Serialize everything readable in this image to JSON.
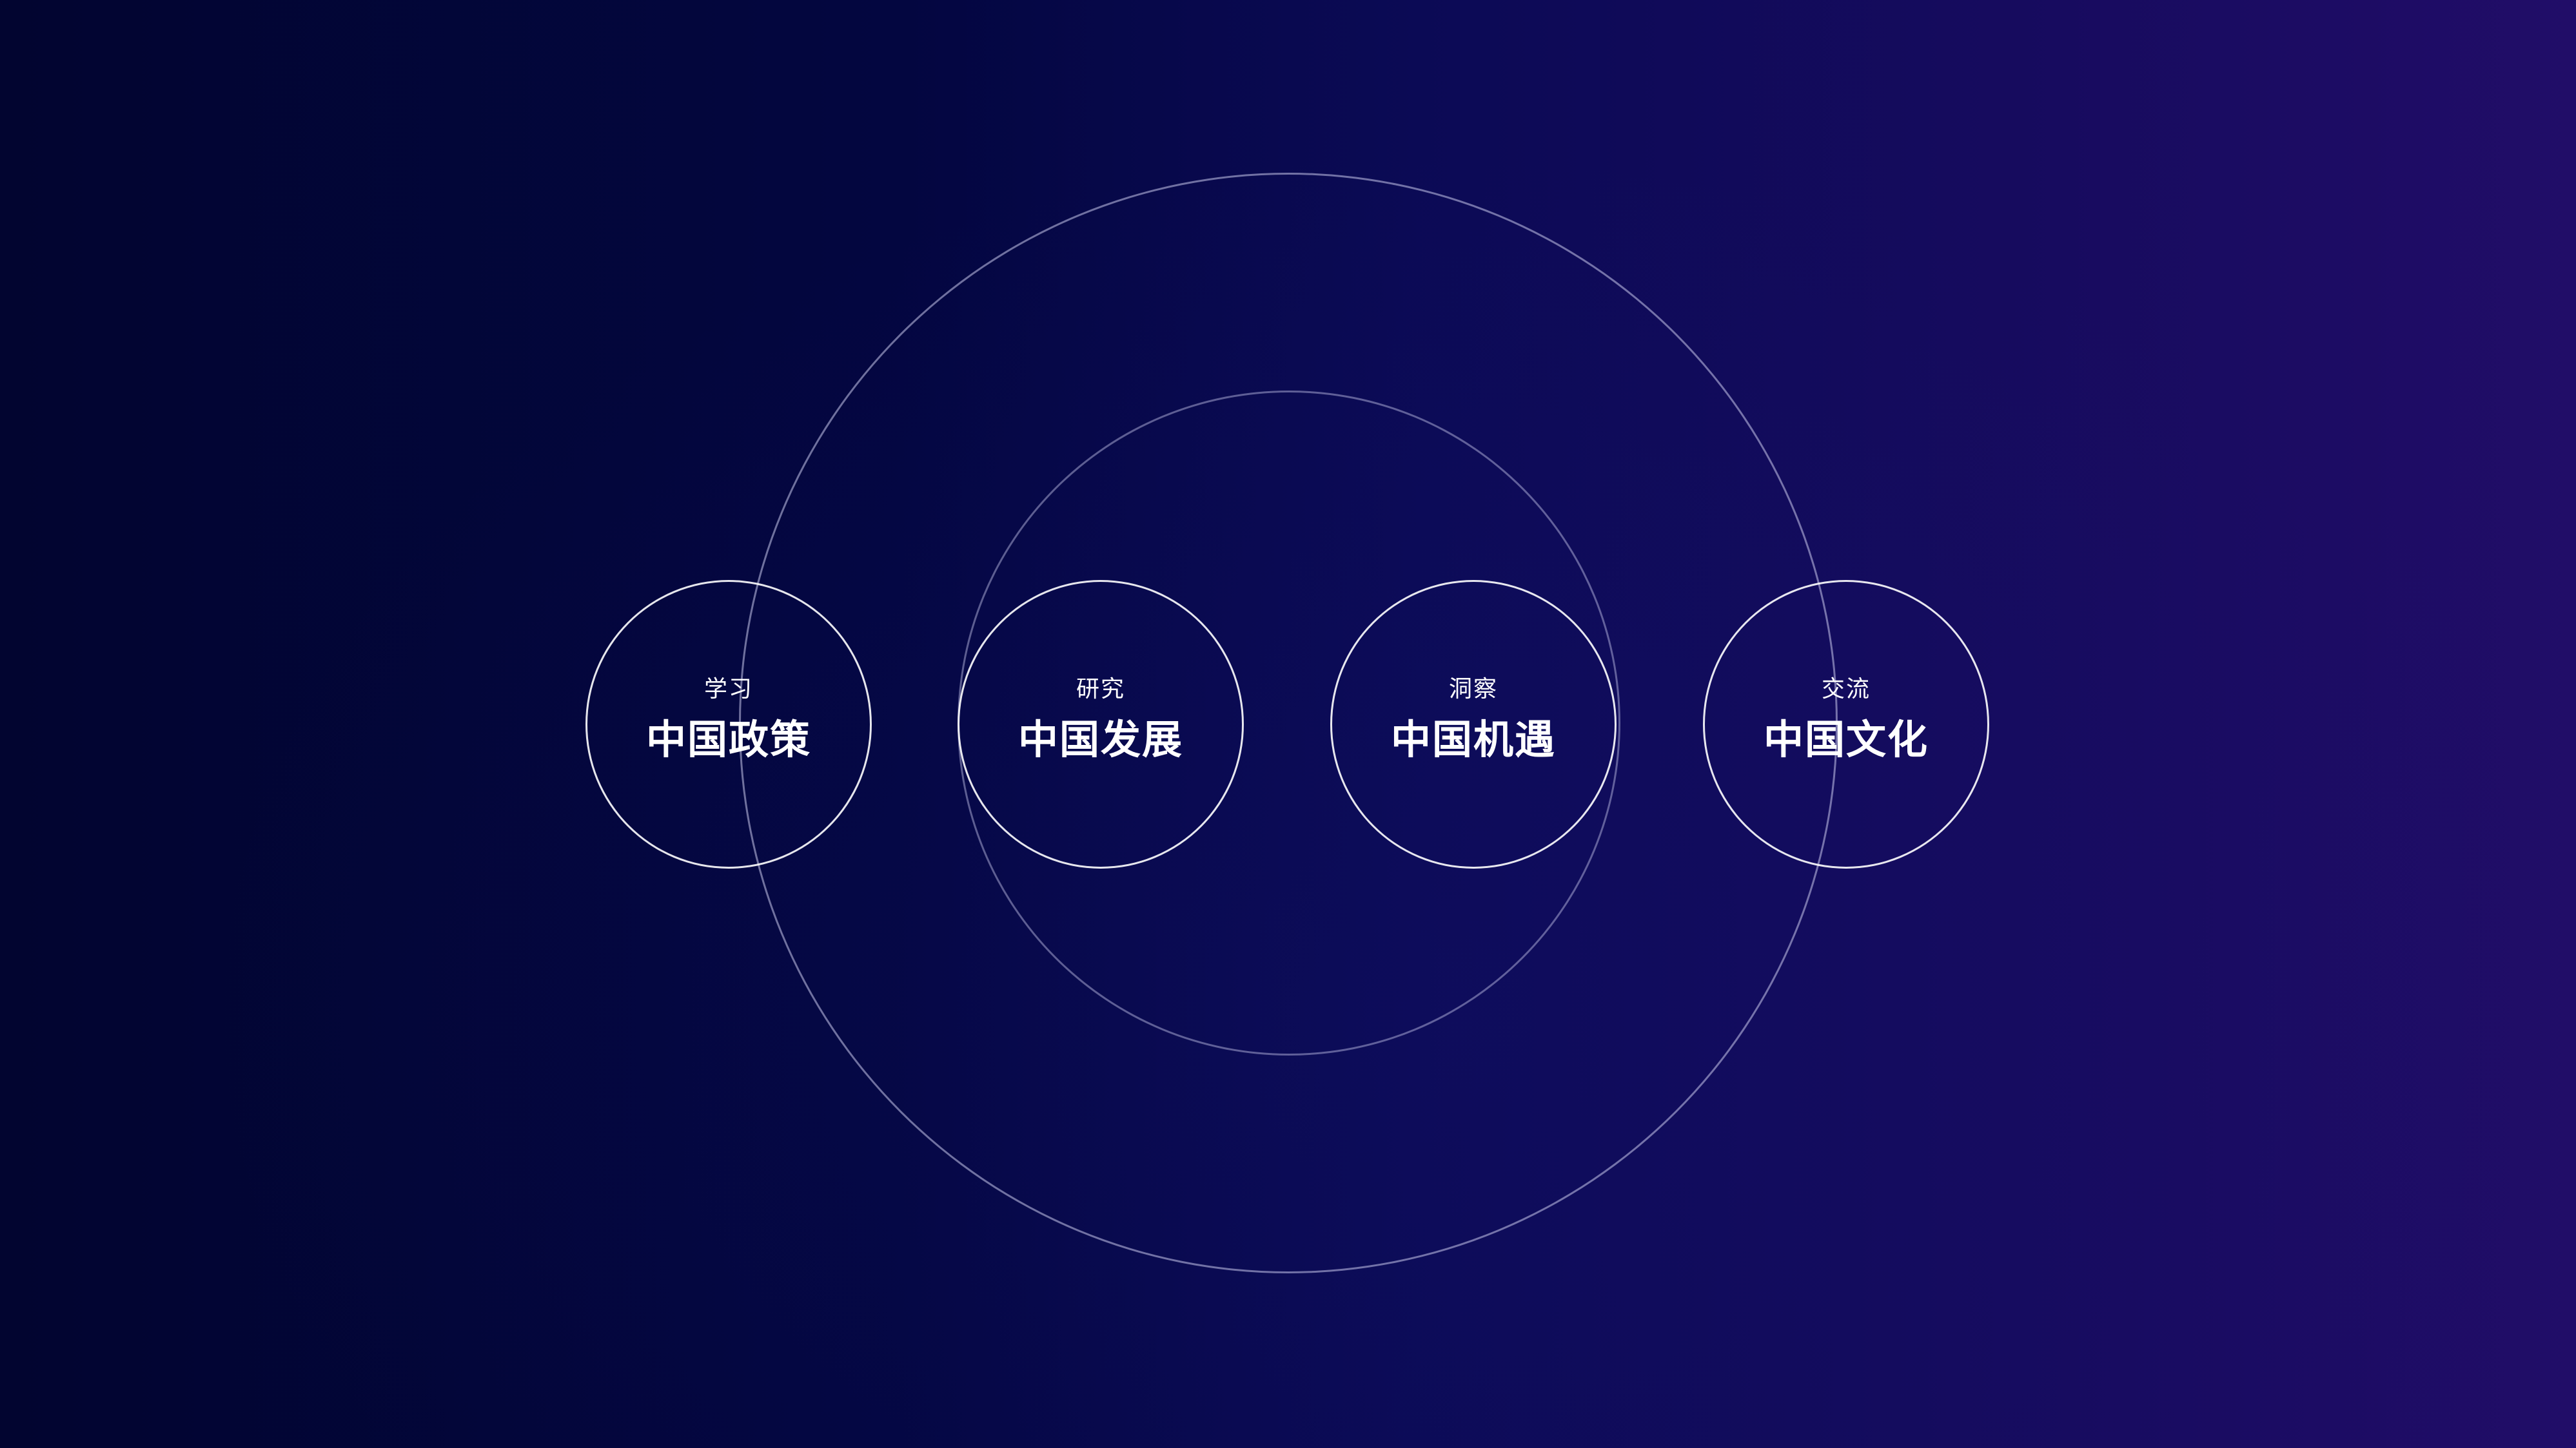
{
  "diagram": {
    "nodes": [
      {
        "subtitle": "学习",
        "title": "中国政策"
      },
      {
        "subtitle": "研究",
        "title": "中国发展"
      },
      {
        "subtitle": "洞察",
        "title": "中国机遇"
      },
      {
        "subtitle": "交流",
        "title": "中国文化"
      }
    ]
  },
  "colors": {
    "background_left": "#020530",
    "background_right": "#210d68",
    "ring_stroke": "#c8c8eb",
    "node_stroke": "#ffffff",
    "text": "#ffffff"
  }
}
